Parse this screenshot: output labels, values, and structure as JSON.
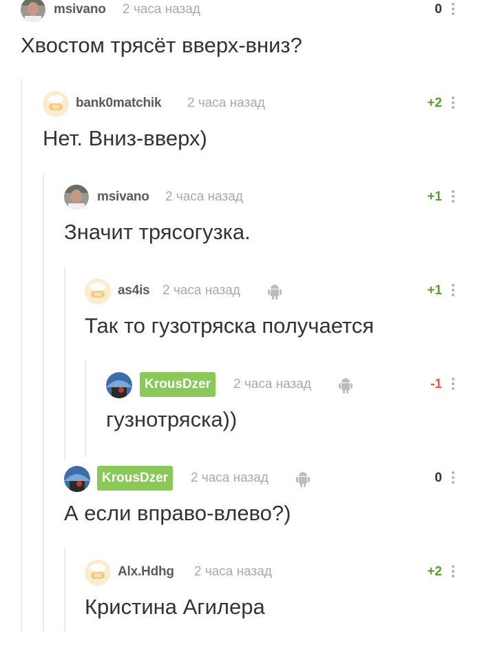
{
  "colors": {
    "positive": "#5a9e2f",
    "negative": "#e8553f",
    "neutral": "#333333",
    "username_badge": "#8ac858"
  },
  "comments": [
    {
      "user": "msivano",
      "time": "2 часа назад",
      "rating": "0",
      "rating_type": "neutral",
      "text": "Хвостом трясёт вверх-вниз?",
      "avatar": "photo-avatar"
    },
    {
      "user": "bank0matchik",
      "time": "2 часа назад",
      "rating": "+2",
      "rating_type": "positive",
      "text": "Нет.  Вниз-вверх)",
      "avatar": "default-avatar"
    },
    {
      "user": "msivano",
      "time": "2 часа назад",
      "rating": "+1",
      "rating_type": "positive",
      "text": "Значит трясогузка.",
      "avatar": "photo-avatar"
    },
    {
      "user": "as4is",
      "time": "2 часа назад",
      "rating": "+1",
      "rating_type": "positive",
      "text": "Так то гузотряска получается",
      "avatar": "default-avatar",
      "android": true
    },
    {
      "user": "KrousDzer",
      "time": "2 часа назад",
      "rating": "-1",
      "rating_type": "negative",
      "text": "гузнотряска))",
      "avatar": "umbrella-avatar",
      "android": true,
      "highlight": true
    },
    {
      "user": "KrousDzer",
      "time": "2 часа назад",
      "rating": "0",
      "rating_type": "neutral",
      "text": "А если вправо-влево?)",
      "avatar": "umbrella-avatar",
      "android": true,
      "highlight": true
    },
    {
      "user": "Alx.Hdhg",
      "time": "2 часа назад",
      "rating": "+2",
      "rating_type": "positive",
      "text": "Кристина Агилера",
      "avatar": "default-avatar"
    }
  ]
}
